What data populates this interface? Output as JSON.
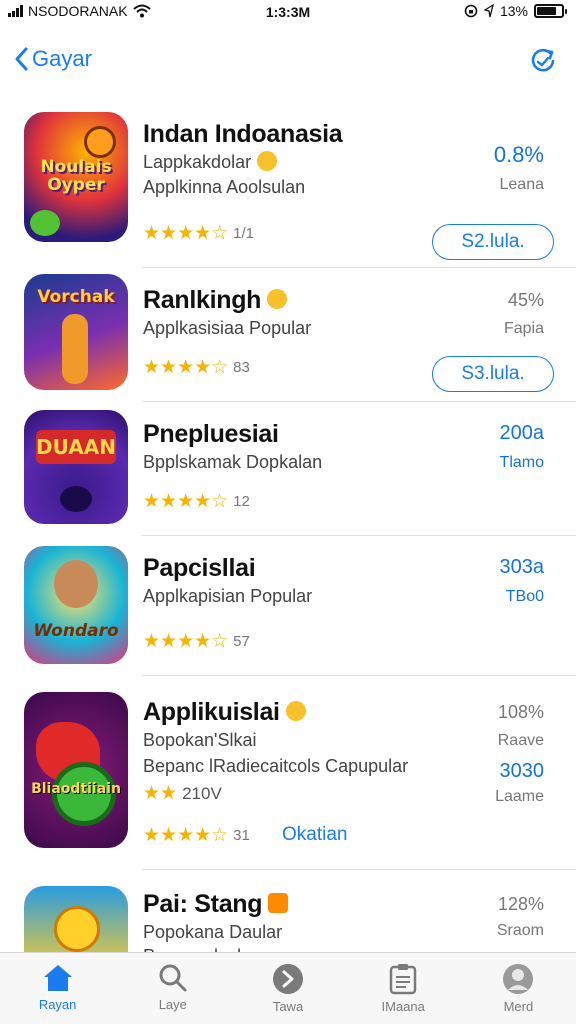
{
  "status": {
    "carrier": "NSODORANAK",
    "time": "1:3:3M",
    "battery": "13%"
  },
  "nav": {
    "back_label": "Gayar",
    "back_icon": "chevron-left-icon",
    "action_icon": "refresh-icon"
  },
  "apps": [
    {
      "name": "Indan Indoanasia",
      "subtitle1": "Lappkakdolar",
      "subtitle2": "Applkinna Aoolsulan",
      "rating_count": "1/1",
      "metric": "0.8%",
      "metric_label": "Leana",
      "button": "S2.lula.",
      "icon_text": "Noulais Oyper"
    },
    {
      "name": "Ranlkingh",
      "subtitle1": "Applkasisiaa Popular",
      "rating_count": "83",
      "metric": "45%",
      "metric_label": "Fapia",
      "button": "S3.lula.",
      "icon_text": "Vorchak"
    },
    {
      "name": "Pnepluesiai",
      "subtitle1": "Bpplskamak Dopkalan",
      "rating_count": "12",
      "metric": "200a",
      "metric_label": "Tlamo",
      "icon_text": "DUAAN"
    },
    {
      "name": "Papcisllai",
      "subtitle1": "Applkapisian Popular",
      "rating_count": "57",
      "metric": "303a",
      "metric_label": "TBo0",
      "icon_text": "Wondaro"
    },
    {
      "name": "Applikuislai",
      "subtitle1": "Bopokan'Slkai",
      "subtitle2": "Bepanc lRadiecaitcols Capupular",
      "small_rating": "210V",
      "rating_count": "31",
      "metric": "108%",
      "metric_label": "Raave",
      "metric2": "3030",
      "metric2_label": "Laame",
      "link": "Okatian",
      "icon_text": "Bliaodtiiain"
    },
    {
      "name": "Pai: Stang",
      "subtitle1": "Popokana Daular",
      "subtitle2": "Ponpoaylsal",
      "metric": "128%",
      "metric_label": "Sraom"
    }
  ],
  "tabs": [
    {
      "label": "Rayan",
      "icon": "home-icon",
      "active": true
    },
    {
      "label": "Laye",
      "icon": "search-icon",
      "active": false
    },
    {
      "label": "Tawa",
      "icon": "arrow-circle-icon",
      "active": false
    },
    {
      "label": "IMaana",
      "icon": "clipboard-icon",
      "active": false
    },
    {
      "label": "Merd",
      "icon": "profile-icon",
      "active": false
    }
  ],
  "colors": {
    "accent": "#1a7cf0",
    "star": "#f4b400"
  }
}
